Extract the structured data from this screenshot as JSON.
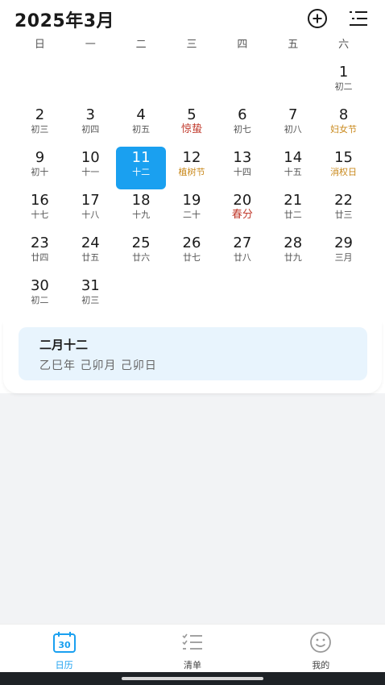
{
  "header": {
    "title": "2025年3月",
    "add_icon": "plus-circle-icon",
    "menu_icon": "list-menu-icon"
  },
  "weekdays": [
    "日",
    "一",
    "二",
    "三",
    "四",
    "五",
    "六"
  ],
  "days": [
    {
      "num": "",
      "lunar": ""
    },
    {
      "num": "",
      "lunar": ""
    },
    {
      "num": "",
      "lunar": ""
    },
    {
      "num": "",
      "lunar": ""
    },
    {
      "num": "",
      "lunar": ""
    },
    {
      "num": "",
      "lunar": ""
    },
    {
      "num": "1",
      "lunar": "初二"
    },
    {
      "num": "2",
      "lunar": "初三"
    },
    {
      "num": "3",
      "lunar": "初四"
    },
    {
      "num": "4",
      "lunar": "初五"
    },
    {
      "num": "5",
      "lunar": "惊蛰",
      "kind": "term"
    },
    {
      "num": "6",
      "lunar": "初七"
    },
    {
      "num": "7",
      "lunar": "初八"
    },
    {
      "num": "8",
      "lunar": "妇女节",
      "kind": "festival"
    },
    {
      "num": "9",
      "lunar": "初十"
    },
    {
      "num": "10",
      "lunar": "十一"
    },
    {
      "num": "11",
      "lunar": "十二",
      "selected": true
    },
    {
      "num": "12",
      "lunar": "植树节",
      "kind": "festival"
    },
    {
      "num": "13",
      "lunar": "十四"
    },
    {
      "num": "14",
      "lunar": "十五"
    },
    {
      "num": "15",
      "lunar": "消权日",
      "kind": "festival"
    },
    {
      "num": "16",
      "lunar": "十七"
    },
    {
      "num": "17",
      "lunar": "十八"
    },
    {
      "num": "18",
      "lunar": "十九"
    },
    {
      "num": "19",
      "lunar": "二十"
    },
    {
      "num": "20",
      "lunar": "春分",
      "kind": "term"
    },
    {
      "num": "21",
      "lunar": "廿二"
    },
    {
      "num": "22",
      "lunar": "廿三"
    },
    {
      "num": "23",
      "lunar": "廿四"
    },
    {
      "num": "24",
      "lunar": "廿五"
    },
    {
      "num": "25",
      "lunar": "廿六"
    },
    {
      "num": "26",
      "lunar": "廿七"
    },
    {
      "num": "27",
      "lunar": "廿八"
    },
    {
      "num": "28",
      "lunar": "廿九"
    },
    {
      "num": "29",
      "lunar": "三月"
    },
    {
      "num": "30",
      "lunar": "初二"
    },
    {
      "num": "31",
      "lunar": "初三"
    }
  ],
  "selected_info": {
    "lunar_date": "二月十二",
    "ganzhi": "乙巳年 己卯月 己卯日"
  },
  "tabs": [
    {
      "label": "日历",
      "icon": "calendar-icon",
      "active": true
    },
    {
      "label": "清单",
      "icon": "checklist-icon",
      "active": false
    },
    {
      "label": "我的",
      "icon": "smiley-icon",
      "active": false
    }
  ],
  "colors": {
    "accent": "#1aa0f0",
    "solar_term": "#c0392b",
    "festival": "#c9891c"
  }
}
